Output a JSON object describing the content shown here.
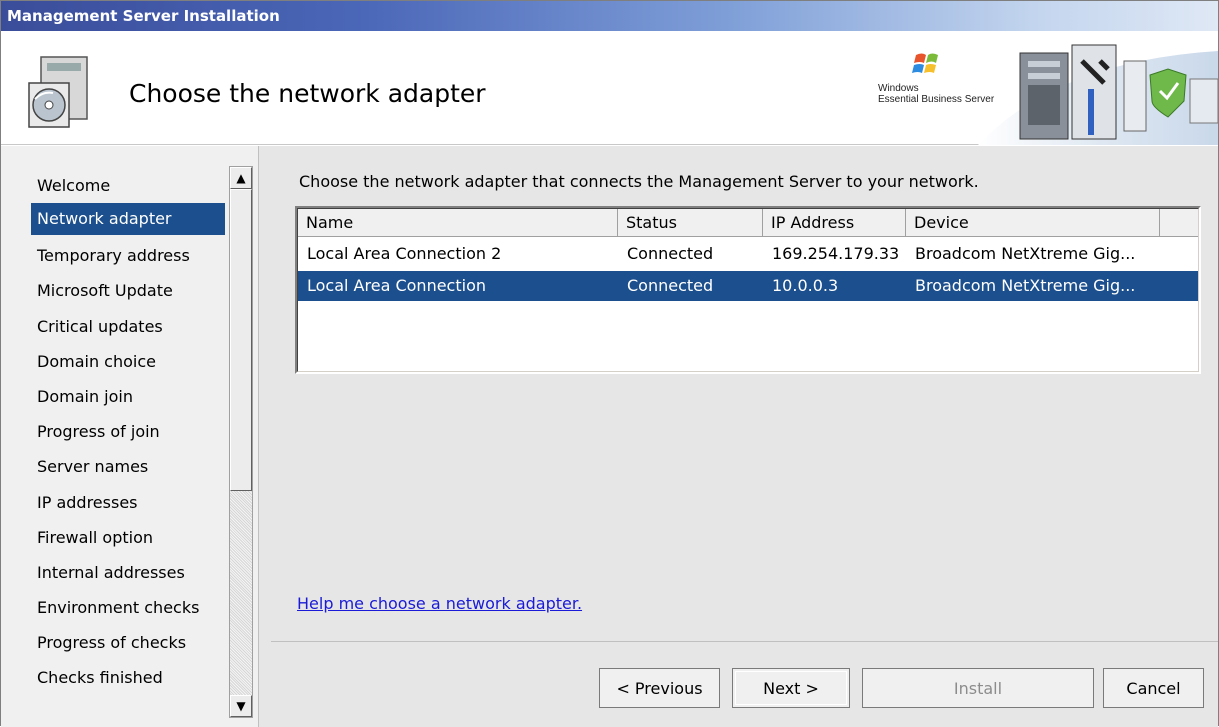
{
  "window": {
    "title": "Management Server Installation"
  },
  "header": {
    "title": "Choose the network adapter",
    "brand_line1": "Windows",
    "brand_line2": "Essential Business Server"
  },
  "nav": {
    "items": [
      "Welcome",
      "Network adapter",
      "Temporary address",
      "Microsoft Update",
      "Critical updates",
      "Domain choice",
      "Domain join",
      "Progress of join",
      "Server names",
      "IP addresses",
      "Firewall option",
      "Internal addresses",
      "Environment checks",
      "Progress of checks",
      "Checks finished"
    ],
    "selected_index": 1
  },
  "main": {
    "prompt": "Choose the network adapter that connects the Management Server to your network.",
    "columns": [
      "Name",
      "Status",
      "IP Address",
      "Device"
    ],
    "rows": [
      {
        "name": "Local Area Connection 2",
        "status": "Connected",
        "ip": "169.254.179.33",
        "device": "Broadcom NetXtreme Gig..."
      },
      {
        "name": "Local Area Connection",
        "status": "Connected",
        "ip": "10.0.0.3",
        "device": "Broadcom NetXtreme Gig..."
      }
    ],
    "selected_row": 1,
    "help_link": "Help me choose a network adapter."
  },
  "buttons": {
    "previous": "< Previous",
    "next": "Next >",
    "install": "Install",
    "cancel": "Cancel"
  },
  "colors": {
    "selection": "#1c4f8d",
    "link": "#1a1ad8"
  }
}
